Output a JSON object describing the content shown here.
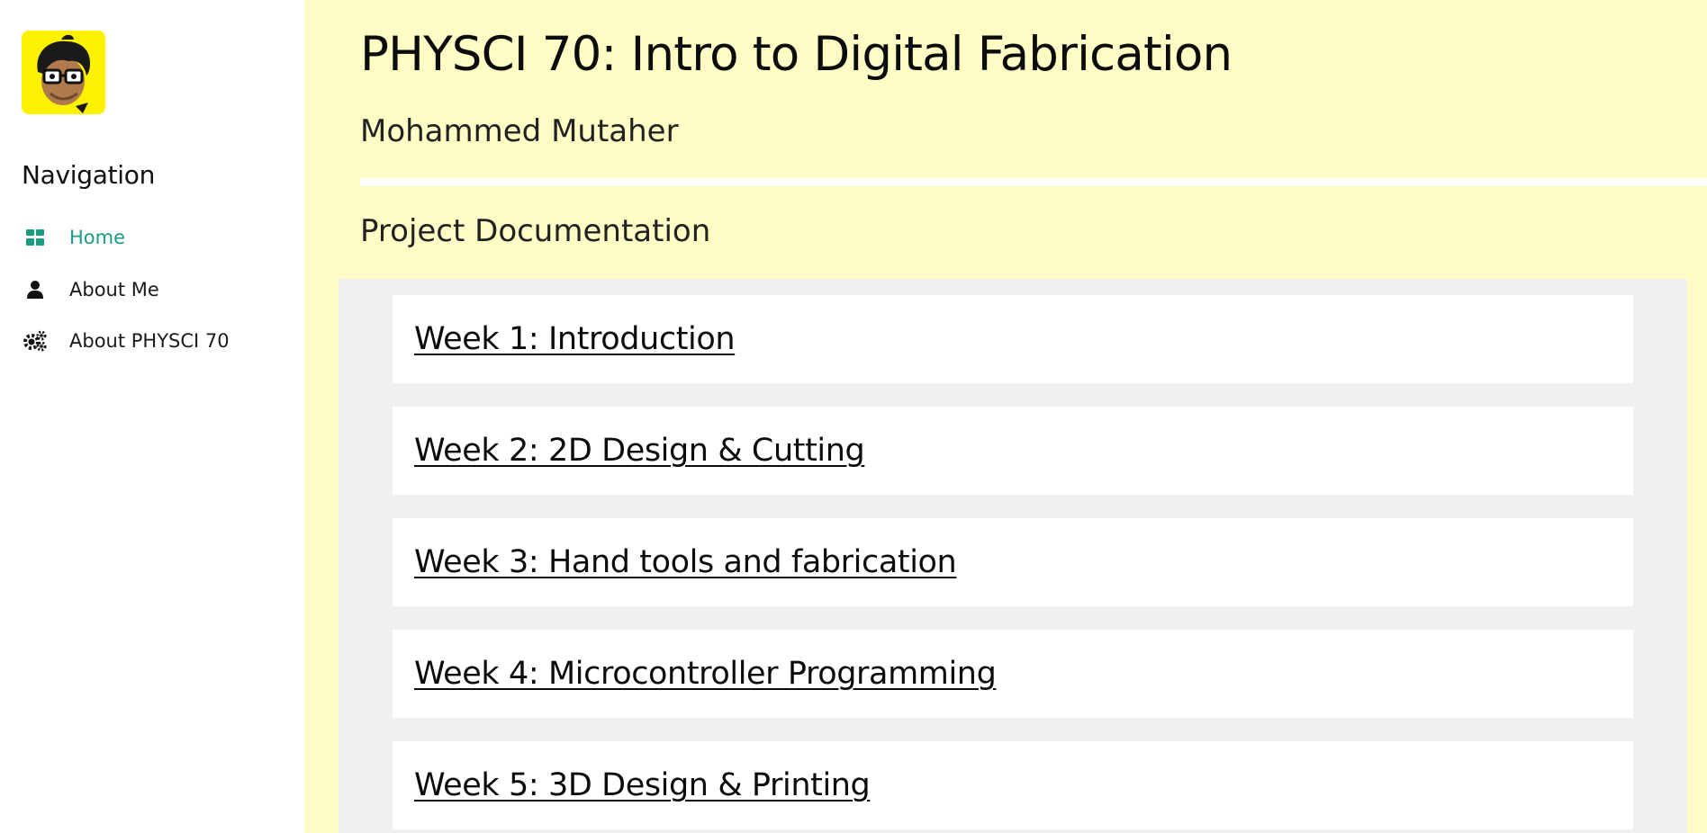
{
  "sidebar": {
    "avatar_icon": "cartoon-avatar-icon",
    "avatar_bg": "#fff200",
    "nav_title": "Navigation",
    "items": [
      {
        "label": "Home",
        "icon": "dashboard-grid-icon",
        "active": true
      },
      {
        "label": "About Me",
        "icon": "user-icon",
        "active": false
      },
      {
        "label": "About PHYSCI 70",
        "icon": "gears-icon",
        "active": false
      }
    ]
  },
  "header": {
    "title": "PHYSCI 70: Intro to Digital Fabrication",
    "author": "Mohammed Mutaher"
  },
  "main": {
    "section_title": "Project Documentation",
    "weeks": [
      {
        "label": "Week 1: Introduction"
      },
      {
        "label": "Week 2: 2D Design & Cutting"
      },
      {
        "label": "Week 3: Hand tools and fabrication"
      },
      {
        "label": "Week 4: Microcontroller Programming"
      },
      {
        "label": "Week 5: 3D Design & Printing"
      }
    ]
  },
  "colors": {
    "main_bg": "#fefdc6",
    "accent": "#1a9b83",
    "list_bg": "#f0f0f0"
  }
}
